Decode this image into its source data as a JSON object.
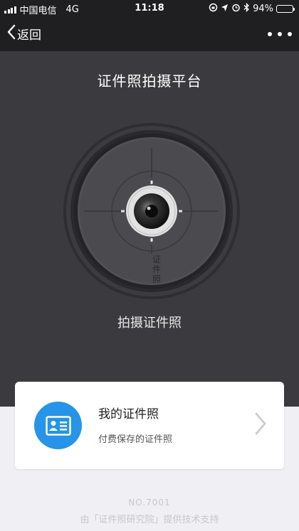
{
  "status_bar": {
    "carrier": "中国电信",
    "network": "4G",
    "time": "11:18",
    "battery": "94%",
    "battery_level": 0.94,
    "icons": [
      "signal-icon",
      "rotation-lock-icon",
      "location-icon",
      "alarm-icon",
      "bluetooth-icon",
      "battery-icon"
    ]
  },
  "nav": {
    "back_label": "返回",
    "more_icon": "more-dots-icon"
  },
  "main": {
    "title": "证件照拍摄平台",
    "dial_text": "证件照",
    "capture_label": "拍摄证件照"
  },
  "card": {
    "icon": "id-card-icon",
    "title": "我的证件照",
    "subtitle": "付费保存的证件照",
    "arrow_icon": "chevron-right-icon"
  },
  "footer": {
    "number": "NO.7001",
    "credit": "由「证件照研究院」提供技术支持"
  },
  "colors": {
    "dark_bg": "#3b3b3f",
    "nav_bg": "#1f1f21",
    "light_bg": "#efeff4",
    "accent_blue": "#2694e8"
  }
}
